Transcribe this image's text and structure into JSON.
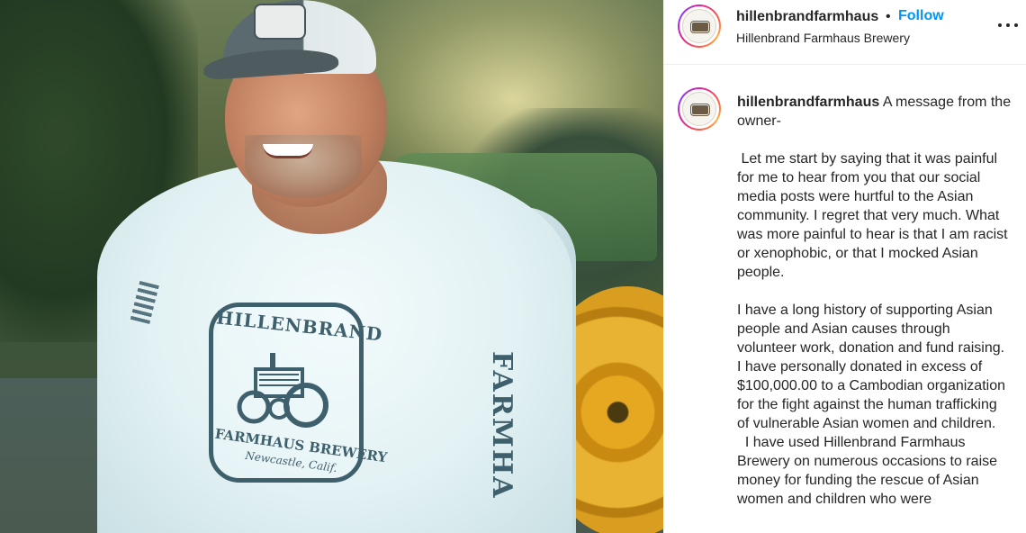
{
  "post": {
    "username": "hillenbrandfarmhaus",
    "separator": "•",
    "follow_label": "Follow",
    "location": "Hillenbrand Farmhaus Brewery"
  },
  "photo": {
    "shirt_logo_top": "HILLENBRAND",
    "shirt_logo_bottom": "FARMHAUS BREWERY",
    "shirt_logo_city": "Newcastle, Calif.",
    "sleeve_text": "FARMHA"
  },
  "caption": {
    "username": "hillenbrandfarmhaus",
    "text": " A message from the owner-\n\n Let me start by saying that it was painful for me to hear from you that our social media posts were hurtful to the Asian community. I regret that very much. What was more painful to hear is that I am racist or xenophobic, or that I mocked Asian people.\n\nI have a long history of supporting Asian people and Asian causes through volunteer work, donation and fund raising. I have personally donated in excess of $100,000.00 to a Cambodian organization for the fight against the human trafficking of vulnerable Asian women and children.\n  I have used Hillenbrand Farmhaus Brewery on numerous occasions to raise money for funding the rescue of Asian women and children who were"
  },
  "icons": {
    "more": "more-options-icon",
    "avatar": "brewery-logo-avatar"
  },
  "colors": {
    "follow": "#0095f6",
    "text": "#262626",
    "divider": "#efefef"
  }
}
